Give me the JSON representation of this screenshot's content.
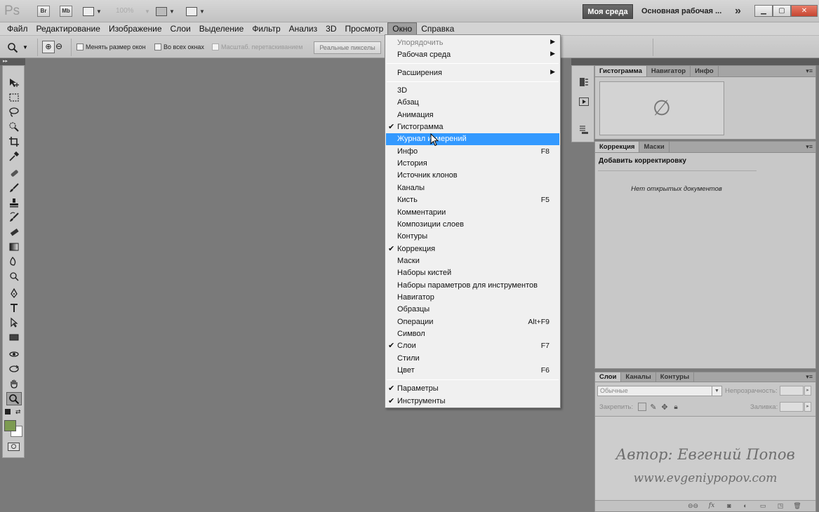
{
  "appbar": {
    "logo": "Ps",
    "bridge": "Br",
    "minibridge": "Mb",
    "zoom": "100%",
    "workspace_active": "Моя среда",
    "workspace_other": "Основная рабочая ...",
    "more": "»"
  },
  "menubar": [
    "Файл",
    "Редактирование",
    "Изображение",
    "Слои",
    "Выделение",
    "Фильтр",
    "Анализ",
    "3D",
    "Просмотр",
    "Окно",
    "Справка"
  ],
  "optbar": {
    "resize_windows": "Менять размер окон",
    "all_windows": "Во всех окнах",
    "scrubby_zoom": "Масштаб. перетаскиванием",
    "actual_pixels": "Реальные пикселы"
  },
  "window_menu": {
    "arrange": "Упорядочить",
    "workspace": "Рабочая среда",
    "extensions": "Расширения",
    "items": [
      {
        "label": "3D",
        "checked": false,
        "shortcut": ""
      },
      {
        "label": "Абзац",
        "checked": false,
        "shortcut": ""
      },
      {
        "label": "Анимация",
        "checked": false,
        "shortcut": ""
      },
      {
        "label": "Гистограмма",
        "checked": true,
        "shortcut": ""
      },
      {
        "label": "Журнал измерений",
        "checked": false,
        "shortcut": "",
        "highlighted": true
      },
      {
        "label": "Инфо",
        "checked": false,
        "shortcut": "F8"
      },
      {
        "label": "История",
        "checked": false,
        "shortcut": ""
      },
      {
        "label": "Источник клонов",
        "checked": false,
        "shortcut": ""
      },
      {
        "label": "Каналы",
        "checked": false,
        "shortcut": ""
      },
      {
        "label": "Кисть",
        "checked": false,
        "shortcut": "F5"
      },
      {
        "label": "Комментарии",
        "checked": false,
        "shortcut": ""
      },
      {
        "label": "Композиции слоев",
        "checked": false,
        "shortcut": ""
      },
      {
        "label": "Контуры",
        "checked": false,
        "shortcut": ""
      },
      {
        "label": "Коррекция",
        "checked": true,
        "shortcut": ""
      },
      {
        "label": "Маски",
        "checked": false,
        "shortcut": ""
      },
      {
        "label": "Наборы кистей",
        "checked": false,
        "shortcut": ""
      },
      {
        "label": "Наборы параметров для инструментов",
        "checked": false,
        "shortcut": ""
      },
      {
        "label": "Навигатор",
        "checked": false,
        "shortcut": ""
      },
      {
        "label": "Образцы",
        "checked": false,
        "shortcut": ""
      },
      {
        "label": "Операции",
        "checked": false,
        "shortcut": "Alt+F9"
      },
      {
        "label": "Символ",
        "checked": false,
        "shortcut": ""
      },
      {
        "label": "Слои",
        "checked": true,
        "shortcut": "F7"
      },
      {
        "label": "Стили",
        "checked": false,
        "shortcut": ""
      },
      {
        "label": "Цвет",
        "checked": false,
        "shortcut": "F6"
      }
    ],
    "bottom_items": [
      {
        "label": "Параметры",
        "checked": true
      },
      {
        "label": "Инструменты",
        "checked": true
      }
    ]
  },
  "panels": {
    "histogram_tabs": [
      "Гистограмма",
      "Навигатор",
      "Инфо"
    ],
    "histogram_empty": "∅",
    "adjust_tabs": [
      "Коррекция",
      "Маски"
    ],
    "adjust_title": "Добавить корректировку",
    "adjust_empty": "Нет открытых документов",
    "layers_tabs": [
      "Слои",
      "Каналы",
      "Контуры"
    ],
    "blend_mode": "Обычные",
    "opacity_label": "Непрозрачность:",
    "lock_label": "Закрепить:",
    "fill_label": "Заливка:",
    "watermark_author": "Автор: Евгений Попов",
    "watermark_site": "www.evgeniypopov.com"
  },
  "colors": {
    "foreground": "#7d9b52",
    "background": "#ffffff",
    "menu_highlight": "#3399ff"
  }
}
